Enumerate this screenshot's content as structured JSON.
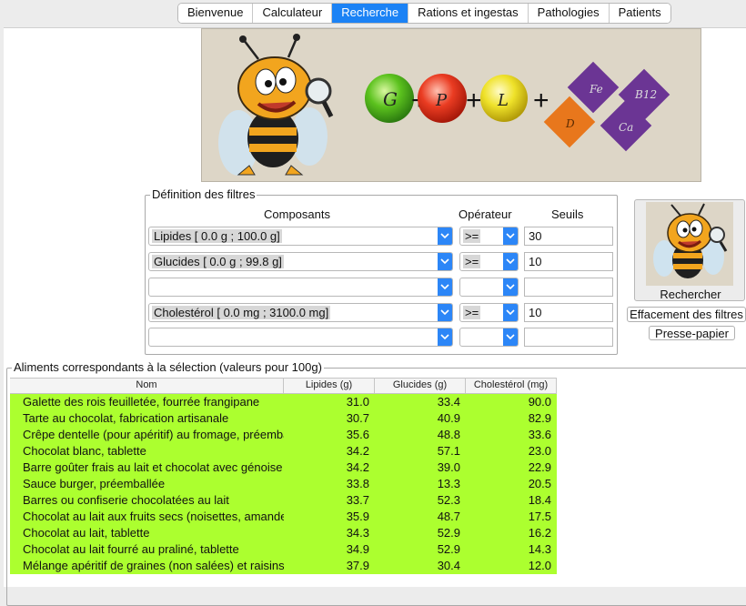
{
  "tabs": [
    "Bienvenue",
    "Calculateur",
    "Recherche",
    "Rations et ingestas",
    "Pathologies",
    "Patients"
  ],
  "active_tab": "Recherche",
  "banner": {
    "balls": [
      "G",
      "P",
      "L"
    ],
    "plus": "+",
    "diamonds": [
      "Fe",
      "B12",
      "D",
      "Ca"
    ]
  },
  "filters": {
    "legend": "Définition des filtres",
    "col_components": "Composants",
    "col_operator": "Opérateur",
    "col_threshold": "Seuils",
    "rows": [
      {
        "component": "Lipides [ 0.0 g ; 100.0 g]",
        "operator": ">=",
        "threshold": "30"
      },
      {
        "component": "Glucides [ 0.0 g ; 99.8 g]",
        "operator": ">=",
        "threshold": "10"
      },
      {
        "component": "",
        "operator": "",
        "threshold": ""
      },
      {
        "component": "Cholestérol [ 0.0 mg ; 3100.0 mg]",
        "operator": ">=",
        "threshold": "10"
      },
      {
        "component": "",
        "operator": "",
        "threshold": ""
      }
    ]
  },
  "actions": {
    "search": "Rechercher",
    "clear": "Effacement des filtres",
    "clipboard": "Presse-papier"
  },
  "results": {
    "legend": "Aliments correspondants à la sélection (valeurs pour 100g)",
    "columns": [
      "Nom",
      "Lipides (g)",
      "Glucides (g)",
      "Cholestérol (mg)"
    ],
    "rows": [
      [
        "Galette des rois feuilletée, fourrée frangipane",
        "31.0",
        "33.4",
        "90.0"
      ],
      [
        "Tarte au chocolat, fabrication artisanale",
        "30.7",
        "40.9",
        "82.9"
      ],
      [
        "Crêpe dentelle (pour apéritif) au fromage, préemballée",
        "35.6",
        "48.8",
        "33.6"
      ],
      [
        "Chocolat blanc, tablette",
        "34.2",
        "57.1",
        "23.0"
      ],
      [
        "Barre goûter frais au lait et chocolat avec génoise",
        "34.2",
        "39.0",
        "22.9"
      ],
      [
        "Sauce burger, préemballée",
        "33.8",
        "13.3",
        "20.5"
      ],
      [
        "Barres ou confiserie chocolatées au lait",
        "33.7",
        "52.3",
        "18.4"
      ],
      [
        "Chocolat au lait aux fruits secs (noisettes, amandes)",
        "35.9",
        "48.7",
        "17.5"
      ],
      [
        "Chocolat au lait, tablette",
        "34.3",
        "52.9",
        "16.2"
      ],
      [
        "Chocolat au lait fourré au praliné, tablette",
        "34.9",
        "52.9",
        "14.3"
      ],
      [
        "Mélange apéritif de graines (non salées) et raisins secs",
        "37.9",
        "30.4",
        "12.0"
      ]
    ]
  },
  "colors": {
    "accent": "#1b82f5",
    "row_highlight": "#acff2f",
    "banner_bg": "#ddd6c7"
  }
}
